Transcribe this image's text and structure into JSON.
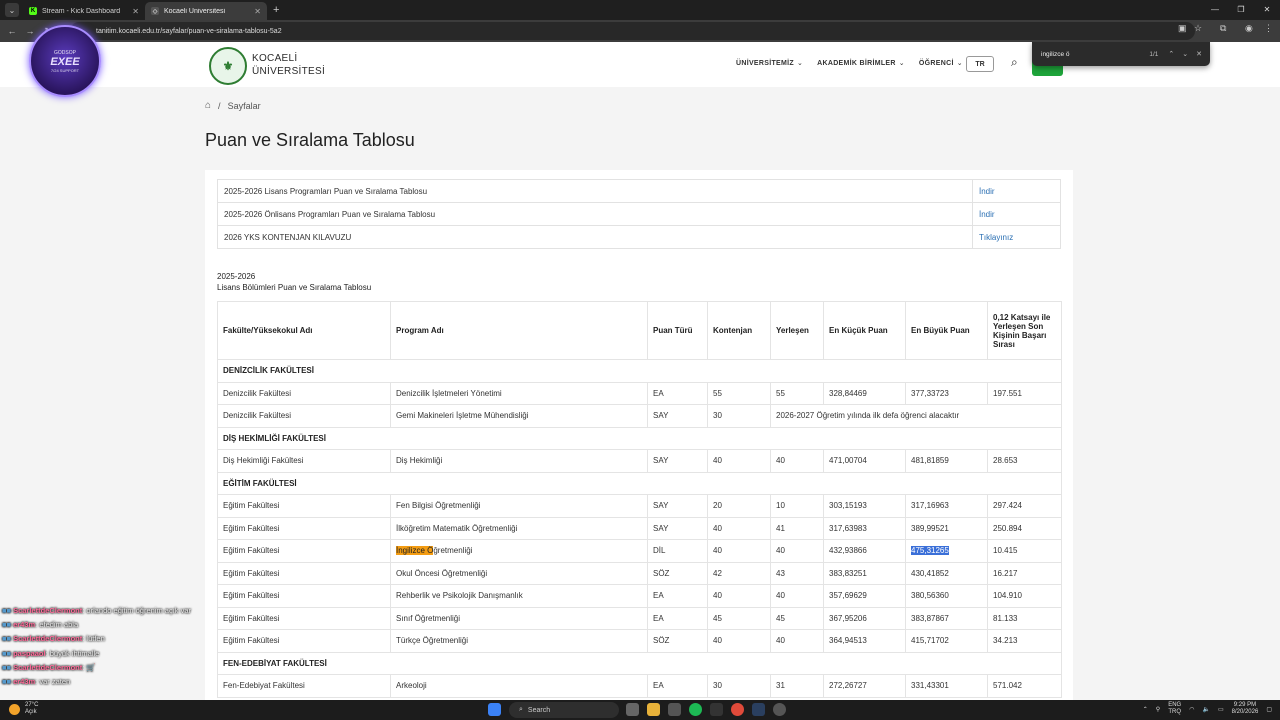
{
  "browser": {
    "tabs": [
      {
        "title": "Stream - Kick Dashboard",
        "active": false
      },
      {
        "title": "Kocaeli Üniversitesi",
        "active": true
      }
    ],
    "url": "tanitim.kocaeli.edu.tr/sayfalar/puan-ve-siralama-tablosu-5a2",
    "find": {
      "query": "ingilizce ö",
      "count": "1/1"
    }
  },
  "site": {
    "logo_line1": "KOCAELİ",
    "logo_line2": "ÜNİVERSİTESİ",
    "nav": [
      "ÜNİVERSİTEMİZ",
      "AKADEMİK BİRİMLER",
      "ÖĞRENCİ"
    ],
    "lang": "TR"
  },
  "breadcrumb": {
    "item": "Sayfalar"
  },
  "page_title": "Puan ve Sıralama Tablosu",
  "documents": [
    {
      "name": "2025-2026 Lisans Programları Puan ve Sıralama Tablosu",
      "link": "İndir"
    },
    {
      "name": "2025-2026 Önlisans Programları Puan ve Sıralama Tablosu",
      "link": "İndir"
    },
    {
      "name": "2026 YKS KONTENJAN KILAVUZU",
      "link": "Tıklayınız"
    }
  ],
  "caption": {
    "line1": "2025-2026",
    "line2": "Lisans Bölümleri Puan ve Sıralama Tablosu"
  },
  "table": {
    "headers": [
      "Fakülte/Yüksekokul Adı",
      "Program Adı",
      "Puan Türü",
      "Kontenjan",
      "Yerleşen",
      "En Küçük Puan",
      "En Büyük Puan",
      "0,12 Katsayı ile Yerleşen Son Kişinin Başarı Sırası"
    ],
    "sections": [
      {
        "title": "DENİZCİLİK FAKÜLTESİ",
        "rows": [
          [
            "Denizcilik Fakültesi",
            "Denizcilik İşletmeleri Yönetimi",
            "EA",
            "55",
            "55",
            "328,84469",
            "377,33723",
            "197.551"
          ],
          [
            "Denizcilik Fakültesi",
            "Gemi Makineleri İşletme Mühendisliği",
            "SAY",
            "30",
            "2026-2027 Öğretim yılında ilk defa öğrenci alacaktır"
          ]
        ]
      },
      {
        "title": "DİŞ HEKİMLİĞİ FAKÜLTESİ",
        "rows": [
          [
            "Diş Hekimliği Fakültesi",
            "Diş Hekimliği",
            "SAY",
            "40",
            "40",
            "471,00704",
            "481,81859",
            "28.653"
          ]
        ]
      },
      {
        "title": "EĞİTİM FAKÜLTESİ",
        "rows": [
          [
            "Eğitim Fakültesi",
            "Fen Bilgisi Öğretmenliği",
            "SAY",
            "20",
            "10",
            "303,15193",
            "317,16963",
            "297.424"
          ],
          [
            "Eğitim Fakültesi",
            "İlköğretim Matematik Öğretmenliği",
            "SAY",
            "40",
            "41",
            "317,63983",
            "389,99521",
            "250.894"
          ],
          [
            "Eğitim Fakültesi",
            "İngilizce Öğretmenliği",
            "DİL",
            "40",
            "40",
            "432,93866",
            "475,31265",
            "10.415"
          ],
          [
            "Eğitim Fakültesi",
            "Okul Öncesi Öğretmenliği",
            "SÖZ",
            "42",
            "43",
            "383,83251",
            "430,41852",
            "16.217"
          ],
          [
            "Eğitim Fakültesi",
            "Rehberlik ve Psikolojik Danışmanlık",
            "EA",
            "40",
            "40",
            "357,69629",
            "380,56360",
            "104.910"
          ],
          [
            "Eğitim Fakültesi",
            "Sınıf Öğretmenliği",
            "EA",
            "45",
            "45",
            "367,95206",
            "383,87867",
            "81.133"
          ],
          [
            "Eğitim Fakültesi",
            "Türkçe Öğretmenliği",
            "SÖZ",
            "40",
            "40",
            "364,94513",
            "415,71702",
            "34.213"
          ]
        ]
      },
      {
        "title": "FEN-EDEBİYAT FAKÜLTESİ",
        "rows": [
          [
            "Fen-Edebiyat Fakültesi",
            "Arkeoloji",
            "EA",
            "30",
            "31",
            "272,26727",
            "331,43301",
            "571.042"
          ]
        ]
      }
    ],
    "highlight": {
      "program_match": "İngilizce Ö",
      "program_rest": "ğretmenliği",
      "selected_value": "475,31265"
    }
  },
  "overlay": {
    "cam": {
      "brand": "GODSOP",
      "name": "EXEE",
      "tag": "7/24 SUPPORT"
    },
    "chat": [
      {
        "user": "ScarlettdeClermont",
        "color": "#ff6b9a",
        "msg": ": orlando eğitim öğrenim açık var"
      },
      {
        "user": "er43m",
        "color": "#ff6b9a",
        "msg": ": efedim abla"
      },
      {
        "user": "ScarlettdeClermont",
        "color": "#ff6b9a",
        "msg": ": lütfen"
      },
      {
        "user": "paspaaol",
        "color": "#ff6b9a",
        "msg": ": büyük ihtimalle"
      },
      {
        "user": "ScarlettdeClermont",
        "color": "#ff6b9a",
        "msg": ": 🛒"
      },
      {
        "user": "er43m",
        "color": "#ff6b9a",
        "msg": ": var zaten"
      }
    ]
  },
  "taskbar": {
    "temp": "27°C",
    "weather": "Açık",
    "search": "Search",
    "lang1": "ENG",
    "lang2": "TRQ",
    "time": "9:29 PM",
    "date": "8/20/2026"
  }
}
